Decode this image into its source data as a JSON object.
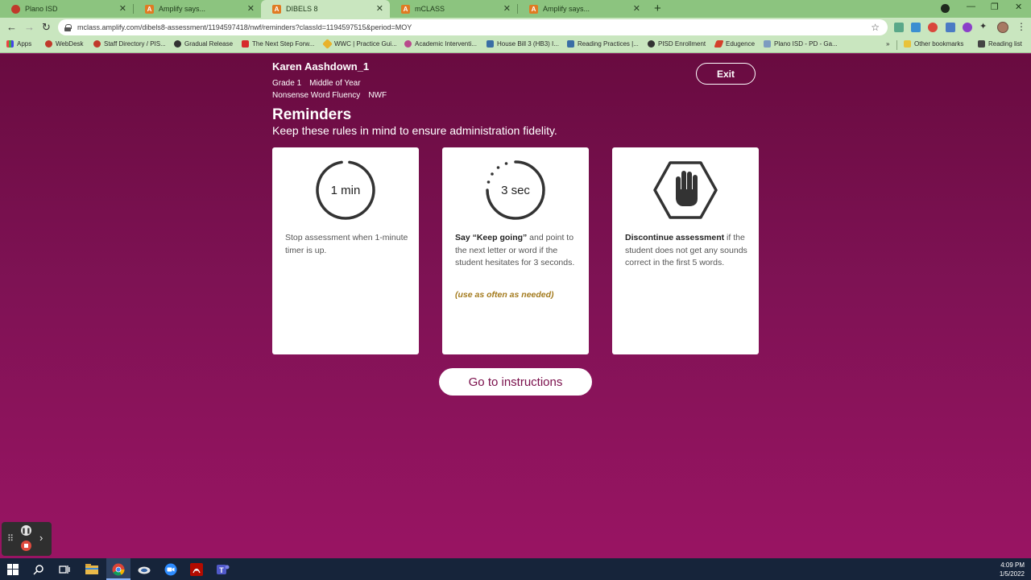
{
  "browser": {
    "tabs": [
      {
        "title": "Plano ISD",
        "favicon": "plano-favicon"
      },
      {
        "title": "Amplify says...",
        "favicon": "amplify-favicon"
      },
      {
        "title": "DIBELS 8",
        "favicon": "amplify-favicon",
        "active": true
      },
      {
        "title": "mCLASS",
        "favicon": "amplify-favicon"
      },
      {
        "title": "Amplify says...",
        "favicon": "amplify-favicon"
      }
    ],
    "url": "mclass.amplify.com/dibels8-assessment/1194597418/nwf/reminders?classId=1194597515&period=MOY",
    "bookmarks": [
      "Apps",
      "WebDesk",
      "Staff Directory / PIS...",
      "Gradual Release",
      "The Next Step Forw...",
      "WWC | Practice Gui...",
      "Academic Interventi...",
      "House Bill 3 (HB3) I...",
      "Reading Practices |...",
      "PISD Enrollment",
      "Edugence",
      "Plano ISD - PD - Ga...",
      "»",
      "Other bookmarks",
      "Reading list"
    ]
  },
  "header": {
    "student_name": "Karen Aashdown_1",
    "grade": "Grade 1",
    "period": "Middle of Year",
    "measure": "Nonsense Word Fluency",
    "measure_code": "NWF",
    "exit_label": "Exit"
  },
  "reminders": {
    "title": "Reminders",
    "subtitle": "Keep these rules in mind to ensure administration fidelity.",
    "cards": [
      {
        "icon_label": "1 min",
        "bold": "",
        "text": "Stop assessment when 1-minute timer is up.",
        "note": ""
      },
      {
        "icon_label": "3 sec",
        "bold": "Say “Keep going”",
        "text": " and point to the next letter or word if the student hesitates for 3 seconds.",
        "note": "(use as often as needed)"
      },
      {
        "icon_label": "",
        "bold": "Discontinue assessment",
        "text": " if the student does not get any sounds correct in the first 5 words.",
        "note": ""
      }
    ],
    "goto_label": "Go to instructions"
  },
  "taskbar": {
    "time": "4:09 PM",
    "date": "1/5/2022"
  },
  "colors": {
    "background_top": "#690b40",
    "background_bottom": "#991463",
    "button_text": "#7a0f4b",
    "note_color": "#a37a1c",
    "tab_bar": "#8cc47f",
    "toolbar": "#c9e6bf"
  }
}
